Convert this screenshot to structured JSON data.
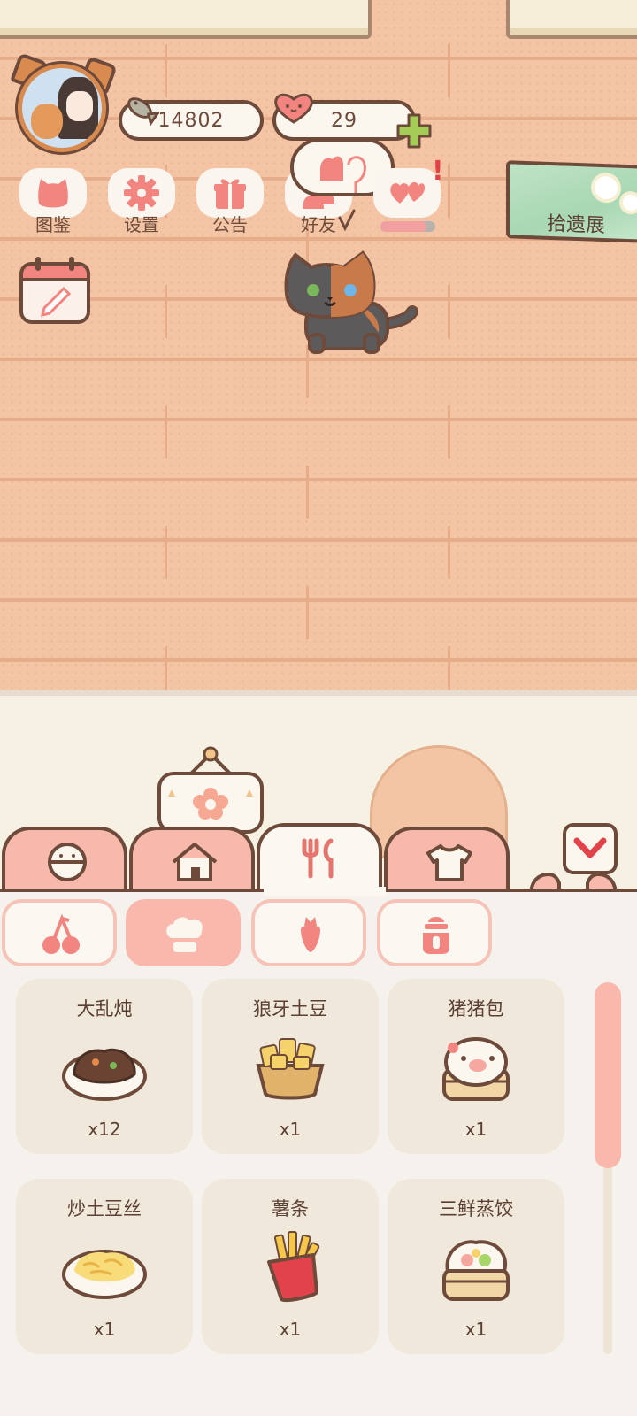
{
  "status": {
    "fish_count": "14802",
    "heart_count": "29"
  },
  "menu": [
    {
      "label": "图鉴",
      "icon": "cat-head-icon"
    },
    {
      "label": "设置",
      "icon": "gear-icon"
    },
    {
      "label": "公告",
      "icon": "gift-icon"
    },
    {
      "label": "好友",
      "icon": "friends-icon"
    }
  ],
  "exhibition": {
    "label": "拾遗展"
  },
  "main_tabs": [
    {
      "icon": "cat-ball-icon"
    },
    {
      "icon": "house-icon"
    },
    {
      "icon": "fork-spoon-icon",
      "active": true
    },
    {
      "icon": "shirt-icon"
    }
  ],
  "sub_categories": [
    {
      "icon": "cherry-icon"
    },
    {
      "icon": "chef-hat-icon",
      "active": true
    },
    {
      "icon": "carrot-icon"
    },
    {
      "icon": "jar-icon"
    }
  ],
  "foods": [
    {
      "name": "大乱炖",
      "qty": "x12",
      "icon": "stew-icon"
    },
    {
      "name": "狼牙土豆",
      "qty": "x1",
      "icon": "potato-icon"
    },
    {
      "name": "猪猪包",
      "qty": "x1",
      "icon": "pig-bun-icon"
    },
    {
      "name": "炒土豆丝",
      "qty": "x1",
      "icon": "shredded-potato-icon"
    },
    {
      "name": "薯条",
      "qty": "x1",
      "icon": "fries-icon"
    },
    {
      "name": "三鲜蒸饺",
      "qty": "x1",
      "icon": "dumpling-icon"
    }
  ],
  "colors": {
    "accent_pink": "#f9b8ab",
    "outline_brown": "#6e4a3b",
    "wall_peach": "#f4c5a4",
    "alert_red": "#e2434a"
  }
}
